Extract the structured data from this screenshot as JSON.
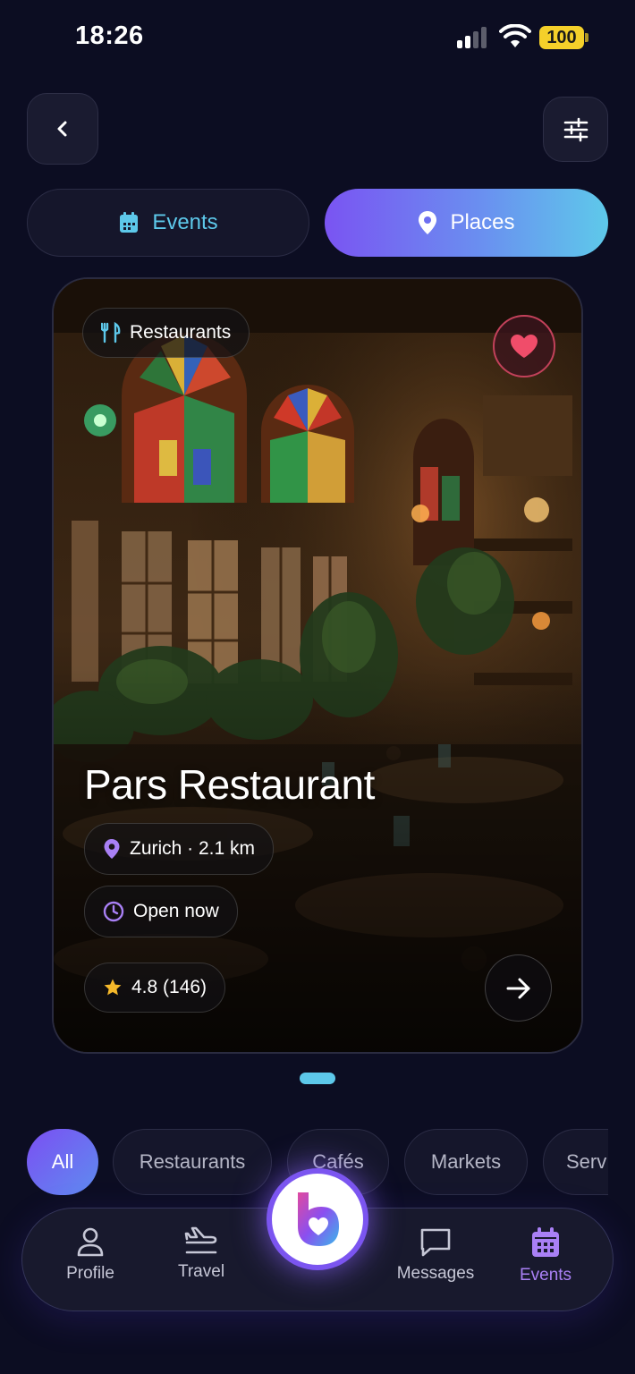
{
  "status_bar": {
    "time": "18:26",
    "battery": "100"
  },
  "header": {
    "back_icon": "chevron-left-icon",
    "filter_icon": "sliders-icon"
  },
  "segments": [
    {
      "label": "Events",
      "icon": "calendar-icon",
      "active": false
    },
    {
      "label": "Places",
      "icon": "location-pin-icon",
      "active": true
    }
  ],
  "card": {
    "category": "Restaurants",
    "category_icon": "fork-knife-icon",
    "favorite": true,
    "title": "Pars Restaurant",
    "location": "Zurich · 2.1 km",
    "status": "Open now",
    "rating": "4.8 (146)"
  },
  "pager": {
    "current": 1
  },
  "categories": [
    "All",
    "Restaurants",
    "Cafés",
    "Markets",
    "Serv"
  ],
  "active_category": "All",
  "nav": [
    {
      "label": "Profile",
      "icon": "person-icon"
    },
    {
      "label": "Travel",
      "icon": "airplane-icon"
    },
    {
      "label": "Messages",
      "icon": "chat-icon"
    },
    {
      "label": "Events",
      "icon": "calendar-icon",
      "active": true
    }
  ],
  "colors": {
    "accent_cyan": "#5dc8ea",
    "accent_purple": "#7a54f2",
    "heart": "#f04d6a",
    "star": "#f5b82a",
    "active_nav": "#a980f5"
  }
}
